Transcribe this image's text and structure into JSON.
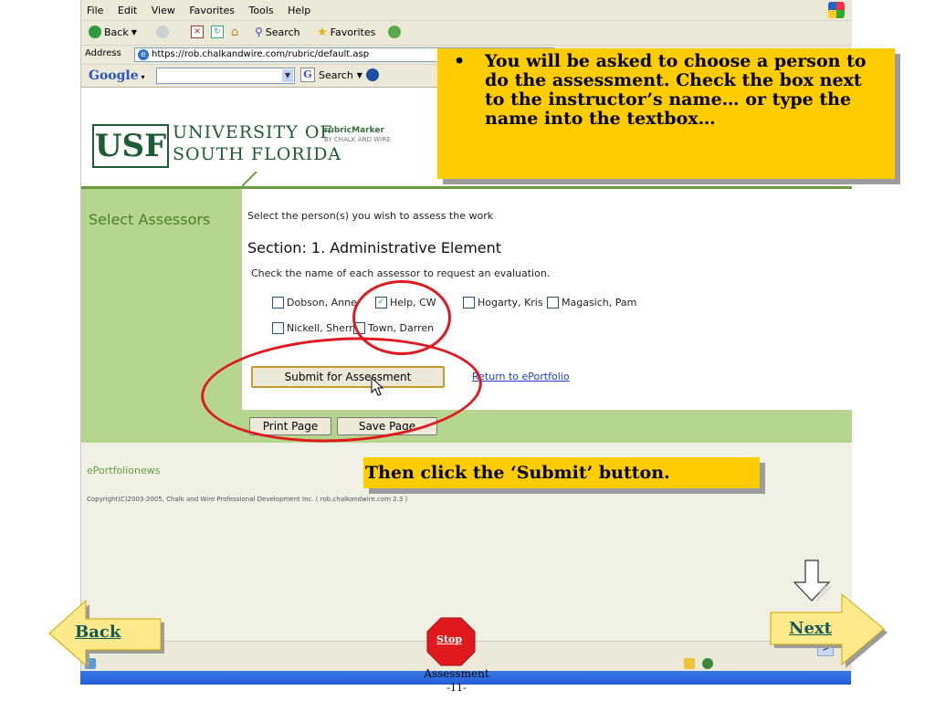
{
  "menubar": [
    "File",
    "Edit",
    "View",
    "Favorites",
    "Tools",
    "Help"
  ],
  "toolbar": {
    "back": "Back",
    "search": "Search",
    "favorites": "Favorites"
  },
  "address": {
    "label": "Address",
    "url": "https://rob.chalkandwire.com/rubric/default.asp"
  },
  "google": {
    "logo": "Google",
    "search_label": "Search"
  },
  "header": {
    "logo_usf": "USF",
    "university_line1": "UNIVERSITY OF",
    "university_line2": "SOUTH FLORIDA",
    "product": "rubricMarker",
    "byline": "BY CHALK AND WIRE"
  },
  "sidebar": {
    "title": "Select Assessors"
  },
  "main": {
    "intro": "Select the person(s) you wish to assess the work",
    "section_title": "Section: 1. Administrative Element",
    "instruction": "Check the name of each assessor to request an evaluation.",
    "assessors": [
      {
        "name": "Dobson, Anne",
        "checked": false
      },
      {
        "name": "Help, CW",
        "checked": true
      },
      {
        "name": "Hogarty, Kris",
        "checked": false
      },
      {
        "name": "Magasich, Pam",
        "checked": false
      },
      {
        "name": "Nickell, Sherrie",
        "checked": false
      },
      {
        "name": "Town, Darren",
        "checked": false
      }
    ],
    "submit_label": "Submit for Assessment",
    "return_link": "Return to ePortfolio",
    "print_label": "Print Page",
    "save_label": "Save Page"
  },
  "footer": {
    "links": [
      "ePortfolio",
      "news"
    ],
    "copyright": "Copyright(C)2003-2005, Chalk and Wire Professional Development Inc.  ( rob.chalkandwire.com 2.3 )"
  },
  "callouts": {
    "top_bullet": "•",
    "top": "You will be asked to choose a person to do the assessment. Check the box next to the instructor’s name… or type the name into the textbox…",
    "bottom": "Then click the ‘Submit’ button."
  },
  "slide_nav": {
    "back": "Back",
    "next": "Next",
    "stop": "Stop",
    "title": "Assessment",
    "page": "-11-"
  },
  "colors": {
    "callout": "#ffcc00",
    "sidebar_green": "#b6d58e",
    "usf_green": "#1d5c32",
    "annotation_red": "#e0191f",
    "nav_arrow": "#ffe98a"
  }
}
